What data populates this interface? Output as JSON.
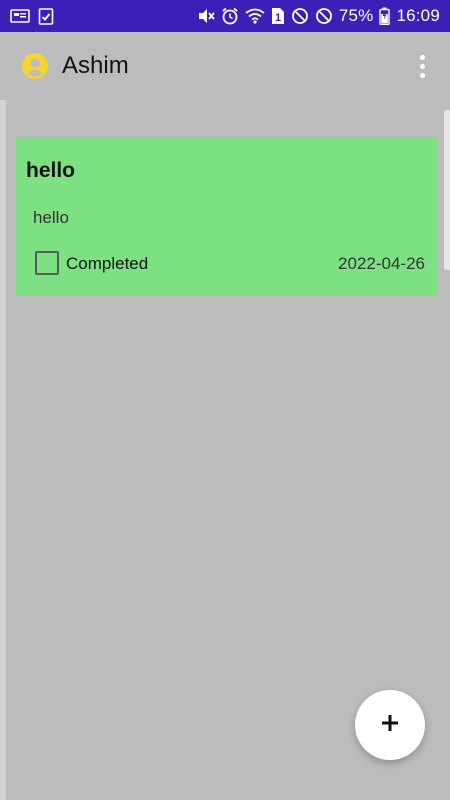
{
  "status_bar": {
    "battery": "75%",
    "time": "16:09",
    "sim_badge": "1",
    "icons": [
      "notification-card-icon",
      "checklist-icon",
      "mute-vibrate-icon",
      "alarm-icon",
      "wifi-icon",
      "sim-icon",
      "do-not-disturb-icon",
      "blocked-icon",
      "battery-charging-icon"
    ]
  },
  "app_bar": {
    "title": "Ashim",
    "avatar_icon": "account-circle-icon",
    "menu_icon": "more-vert-icon"
  },
  "notes": [
    {
      "title": "hello",
      "body": "hello",
      "status_label": "Completed",
      "completed": false,
      "date": "2022-04-26",
      "color": "#7de184"
    }
  ],
  "fab": {
    "label": "+",
    "icon": "add-icon"
  },
  "colors": {
    "status_bar": "#3c1fb6",
    "background": "#bcbcbc",
    "card": "#7de184",
    "avatar": "#f5d531"
  }
}
